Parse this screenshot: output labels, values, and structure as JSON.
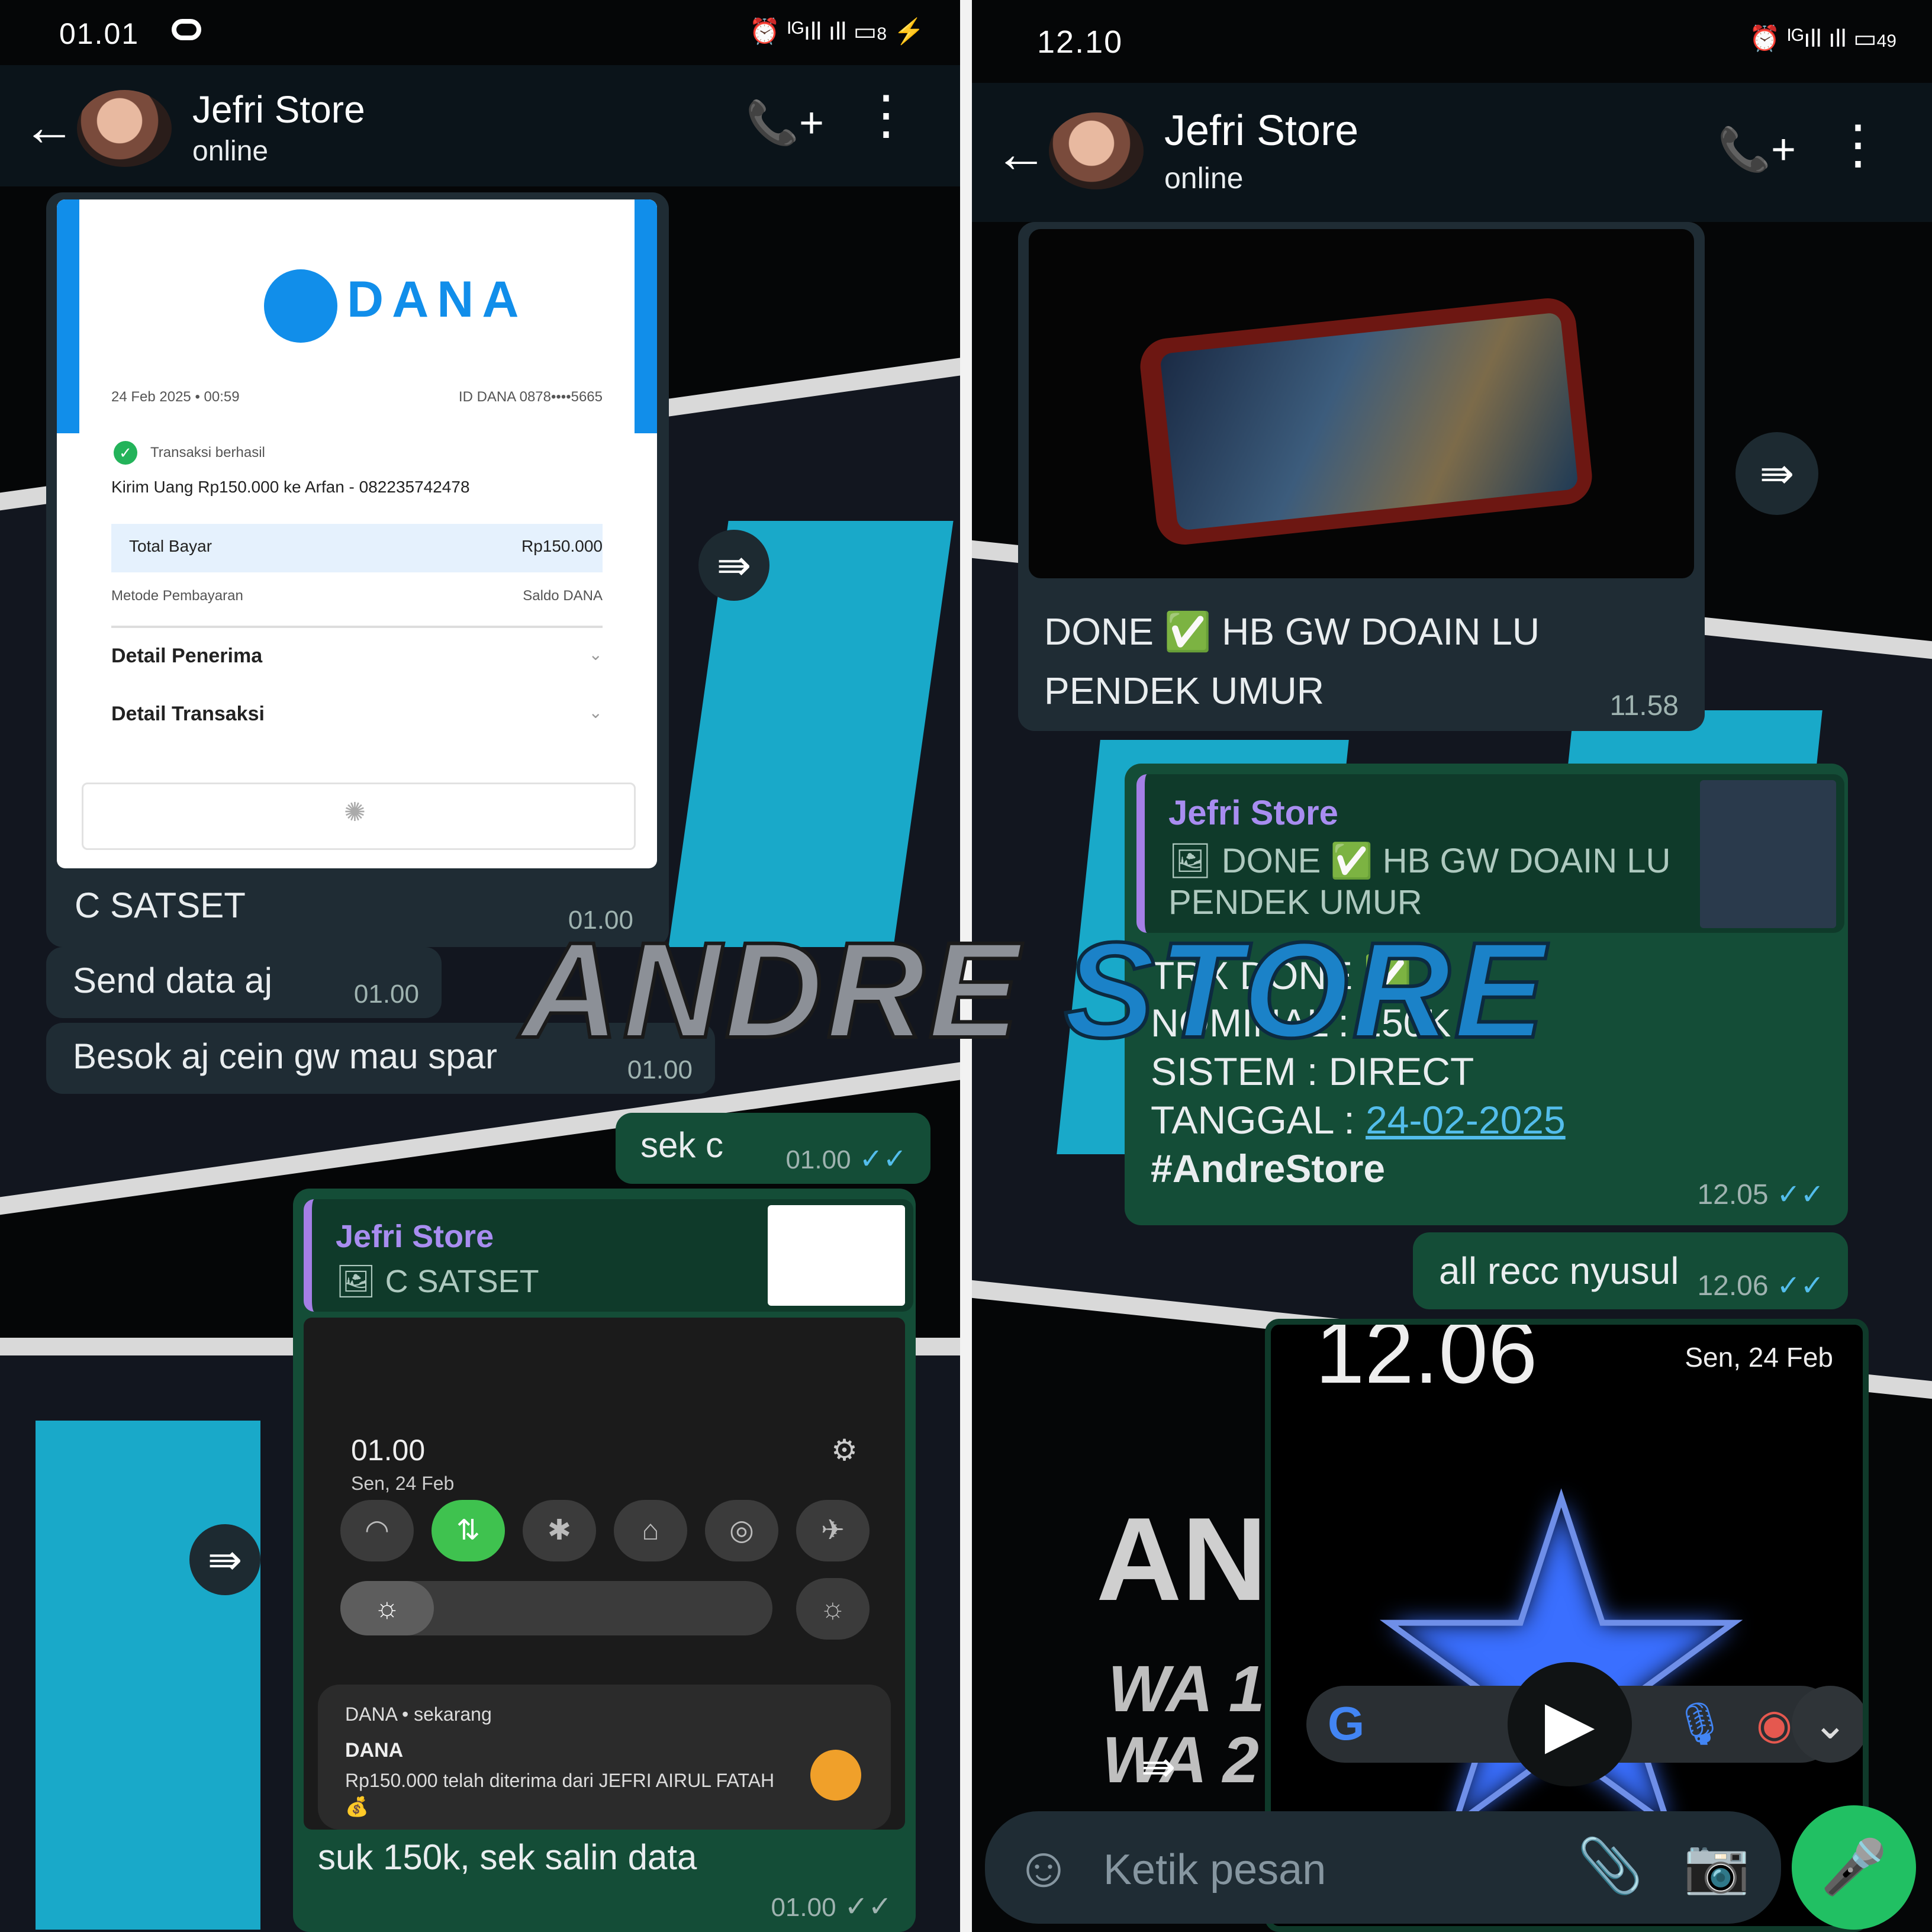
{
  "left": {
    "status_time": "01.01",
    "battery": "8",
    "contact_name": "Jefri Store",
    "contact_status": "online",
    "receipt": {
      "brand": "DANA",
      "date": "24 Feb 2025 • 00:59",
      "dana_id": "ID DANA 0878••••5665",
      "status": "Transaksi berhasil",
      "description": "Kirim Uang Rp150.000 ke Arfan - 082235742478",
      "total_label": "Total Bayar",
      "total_value": "Rp150.000",
      "method_label": "Metode Pembayaran",
      "method_value": "Saldo DANA",
      "recipient_detail": "Detail Penerima",
      "transaction_detail": "Detail Transaksi"
    },
    "messages": [
      {
        "text": "C SATSET",
        "time": "01.00"
      },
      {
        "text": "Send data aj",
        "time": "01.00"
      },
      {
        "text": "Besok aj cein gw mau spar",
        "time": "01.00"
      },
      {
        "text": "sek c",
        "time": "01.00"
      },
      {
        "text": "suk 150k, sek salin data",
        "time": "01.00"
      }
    ],
    "quote": {
      "name": "Jefri Store",
      "text": "C SATSET"
    },
    "quick_settings": {
      "time": "01.00",
      "date": "Sen, 24 Feb",
      "notif_app": "DANA • sekarang",
      "notif_title": "DANA",
      "notif_body": "Rp150.000 telah diterima dari JEFRI AIRUL FATAH 💰"
    }
  },
  "right": {
    "status_time": "12.10",
    "battery": "49",
    "contact_name": "Jefri Store",
    "contact_status": "online",
    "photo_caption_1": "DONE ✅ HB GW DOAIN LU",
    "photo_caption_2": "PENDEK UMUR",
    "photo_time": "11.58",
    "quote": {
      "name": "Jefri Store",
      "text_1": "DONE ✅ HB GW DOAIN LU",
      "text_2": "PENDEK UMUR"
    },
    "trx": {
      "line1": "TRX DONE ✅",
      "line2": "NOMINAL : 150K",
      "line3": "SISTEM : DIRECT",
      "date_label": "TANGGAL : ",
      "date_value": "24-02-2025",
      "tag": "#AndreStore",
      "time": "12.05"
    },
    "msg_all": {
      "text": "all recc nyusul",
      "time": "12.06"
    },
    "video": {
      "time": "12.06",
      "date": "Sen, 24 Feb",
      "banner_1": "ANI",
      "banner_2": "WA 1",
      "banner_3": "WA 2"
    },
    "input_placeholder": "Ketik pesan"
  },
  "watermark": {
    "part1": "ANDRE ",
    "part2": "STORE"
  },
  "colors": {
    "outgoing_bubble": "#144d37",
    "incoming_bubble": "#1f2c34",
    "read_ticks": "#53bdeb",
    "dana_blue": "#118eea"
  }
}
